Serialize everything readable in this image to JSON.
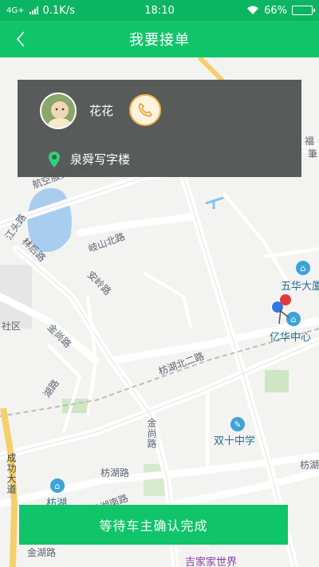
{
  "status_bar": {
    "network": "4G+",
    "speed": "0.1K/s",
    "time": "18:10",
    "battery": "66%",
    "battery_level": 0.66
  },
  "header": {
    "title": "我要接单",
    "back_icon": "chevron-left-icon"
  },
  "driver_card": {
    "name": "花花",
    "phone_icon": "phone-icon",
    "location_icon": "location-pin-icon",
    "location": "泉舜写字楼"
  },
  "map": {
    "labels": {
      "aviation": "航空服务广场",
      "qishan": "岐山北路",
      "linhou": "林后路",
      "jiangtou": "江头路",
      "anling": "安岭路",
      "jinshang1": "金尚路",
      "jinshang2": "金尚路",
      "huli": "湖路",
      "shequ": "社区",
      "hubei2": "枋湖北二路",
      "wuhua": "五华大厦",
      "yihua": "亿华中心",
      "shuangshi": "双十中学",
      "chenggong": "成功大道",
      "fanghu": "枋湖路",
      "fanghu_east": "枋湖",
      "fanghu_south": "枋湖南路",
      "fanghu_right": "枋湖",
      "jinhu": "金湖路",
      "jijiajia": "吉家家世界",
      "fu": "福",
      "zhu": "筆"
    }
  },
  "action": {
    "status_label": "等待车主确认完成"
  },
  "colors": {
    "header": "#11c46a",
    "status_bar": "#0bb562",
    "card_bg": "#525454",
    "phone_ring": "#f0b545"
  }
}
